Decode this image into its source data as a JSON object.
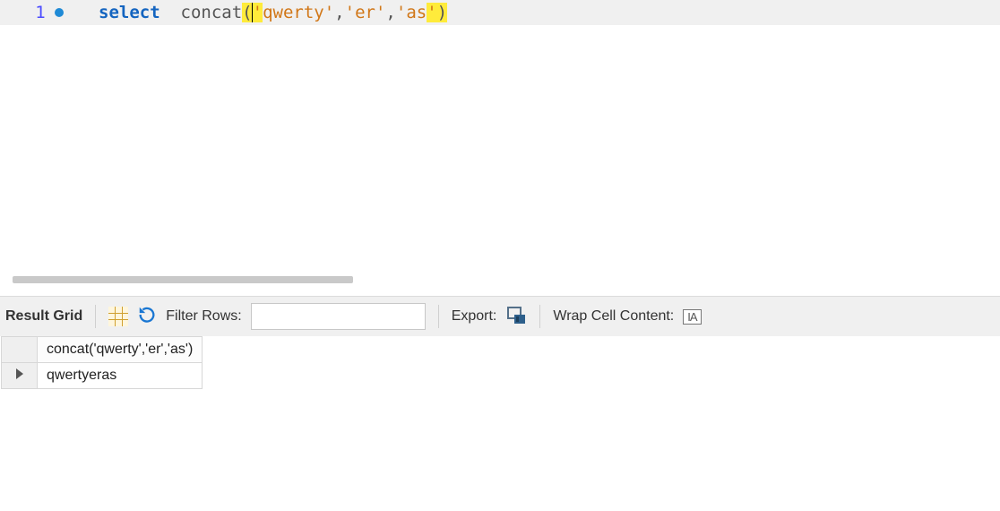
{
  "editor": {
    "line_number": "1",
    "tokens": {
      "kw_select": "select",
      "sp1": "  ",
      "fn": "concat",
      "open": "(",
      "q1a": "'",
      "s1": "qwerty",
      "q1b": "'",
      "c1": ",",
      "q2a": "'",
      "s2": "er",
      "q2b": "'",
      "c2": ",",
      "q3a": "'",
      "s3": "as",
      "q3b": "'",
      "close": ")"
    }
  },
  "toolbar": {
    "result_grid_label": "Result Grid",
    "filter_label": "Filter Rows:",
    "filter_value": "",
    "filter_placeholder": "",
    "export_label": "Export:",
    "wrap_label": "Wrap Cell Content:",
    "wrap_icon_text": "IA"
  },
  "grid": {
    "columns": [
      "concat('qwerty','er','as')"
    ],
    "rows": [
      {
        "cells": [
          "qwertyeras"
        ]
      }
    ]
  }
}
